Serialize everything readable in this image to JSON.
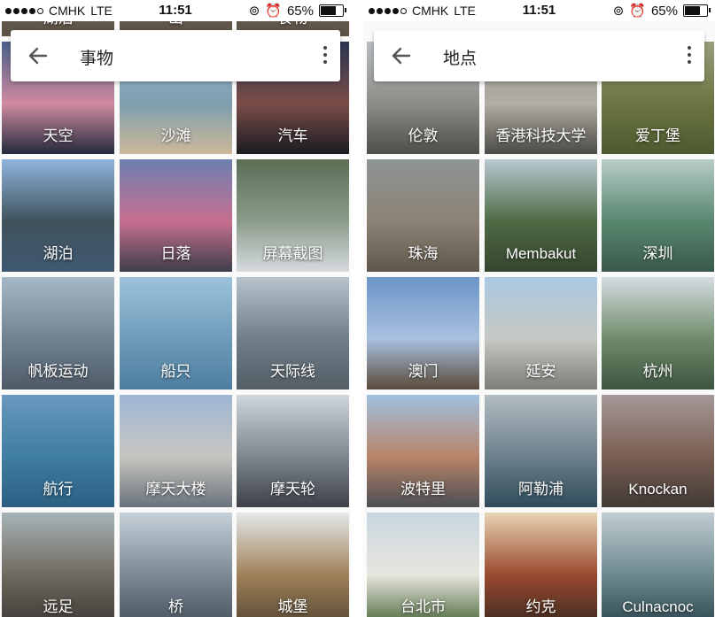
{
  "status_bar": {
    "carrier": "CMHK",
    "network": "LTE",
    "time": "11:51",
    "battery": "65%",
    "battery_level": 0.65
  },
  "left": {
    "title": "事物",
    "top_partial_labels": [
      "湖泊",
      "山",
      "食物"
    ],
    "tiles": [
      {
        "label": "天空",
        "colors": [
          "#4a5f8a",
          "#d08aa0",
          "#232b3c"
        ]
      },
      {
        "label": "沙滩",
        "colors": [
          "#9bb6cf",
          "#7d9fae",
          "#cdb89a"
        ]
      },
      {
        "label": "汽车",
        "colors": [
          "#2b3552",
          "#7a4d48",
          "#1b1c22"
        ]
      },
      {
        "label": "湖泊",
        "colors": [
          "#8fb4de",
          "#40535c",
          "#3f5871"
        ]
      },
      {
        "label": "日落",
        "colors": [
          "#6c80b0",
          "#c66f8f",
          "#3e3e4a"
        ]
      },
      {
        "label": "屏幕截图",
        "colors": [
          "#5c6e55",
          "#8b9b8a",
          "#d6dbe0"
        ]
      },
      {
        "label": "帆板运动",
        "colors": [
          "#a6b8c6",
          "#6f8393",
          "#4f5a66"
        ]
      },
      {
        "label": "船只",
        "colors": [
          "#9cc2da",
          "#6e9bb9",
          "#4d7ea0"
        ]
      },
      {
        "label": "天际线",
        "colors": [
          "#b7c3cc",
          "#707e88",
          "#535e66"
        ]
      },
      {
        "label": "航行",
        "colors": [
          "#6a98c0",
          "#3f7ea2",
          "#2b5f82"
        ]
      },
      {
        "label": "摩天大楼",
        "colors": [
          "#9fb7d3",
          "#c6c6c0",
          "#6a727c"
        ]
      },
      {
        "label": "摩天轮",
        "colors": [
          "#cfd6dc",
          "#7e868e",
          "#3d4148"
        ]
      },
      {
        "label": "远足",
        "colors": [
          "#a8b4b8",
          "#6f6a5f",
          "#3e3b37"
        ]
      },
      {
        "label": "桥",
        "colors": [
          "#c6d1d9",
          "#7b8a95",
          "#4a5560"
        ]
      },
      {
        "label": "城堡",
        "colors": [
          "#e5e8ea",
          "#a08259",
          "#5a4a36"
        ]
      }
    ]
  },
  "right": {
    "title": "地点",
    "tiles": [
      {
        "label": "伦敦",
        "colors": [
          "#b7bdc2",
          "#8c8d86",
          "#4e4d48"
        ]
      },
      {
        "label": "香港科技大学",
        "colors": [
          "#8a8d8f",
          "#b3aea4",
          "#4b4a46"
        ]
      },
      {
        "label": "爱丁堡",
        "colors": [
          "#9a9d7c",
          "#6b7442",
          "#4d5a2f"
        ]
      },
      {
        "label": "珠海",
        "colors": [
          "#8e9496",
          "#8c8275",
          "#60574c"
        ]
      },
      {
        "label": "Membakut",
        "colors": [
          "#b9c9d1",
          "#4f6b45",
          "#35452e"
        ]
      },
      {
        "label": "深圳",
        "colors": [
          "#b8cdc8",
          "#58876f",
          "#3a5a4a"
        ]
      },
      {
        "label": "澳门",
        "colors": [
          "#6b95c8",
          "#a8c0df",
          "#5a4a3a"
        ]
      },
      {
        "label": "延安",
        "colors": [
          "#a9c8e0",
          "#c6c8c4",
          "#7c7d78"
        ]
      },
      {
        "label": "杭州",
        "colors": [
          "#d6dde2",
          "#6f8b6a",
          "#3d5440"
        ]
      },
      {
        "label": "波特里",
        "colors": [
          "#9fc0df",
          "#b88468",
          "#4c4f54"
        ]
      },
      {
        "label": "阿勒浦",
        "colors": [
          "#b3bdc2",
          "#6c808c",
          "#2f4b5a"
        ]
      },
      {
        "label": "Knockan",
        "colors": [
          "#a59998",
          "#7a5e52",
          "#413a36"
        ]
      },
      {
        "label": "台北市",
        "colors": [
          "#c8d6e0",
          "#e8e6de",
          "#4e6b3f"
        ]
      },
      {
        "label": "约克",
        "colors": [
          "#e8d4b4",
          "#9b4b2f",
          "#3e2a20"
        ]
      },
      {
        "label": "Culnacnoc",
        "colors": [
          "#c2cdd3",
          "#6d8a8f",
          "#2f4a52"
        ]
      }
    ]
  }
}
